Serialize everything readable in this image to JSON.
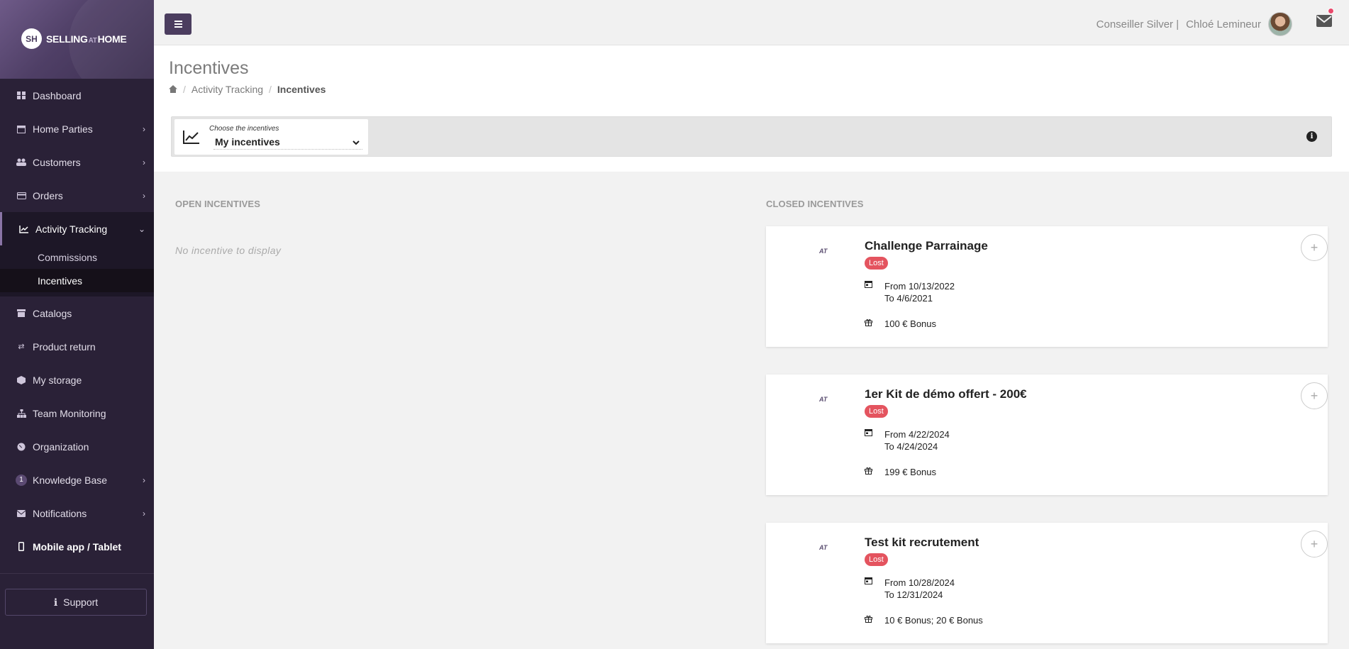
{
  "brand": {
    "logo_mark": "SH",
    "name_part1": "SELLING",
    "name_at": "AT",
    "name_part2": "HOME"
  },
  "sidebar": {
    "items": [
      {
        "label": "Dashboard",
        "icon": "dashboard-icon"
      },
      {
        "label": "Home Parties",
        "icon": "calendar-icon"
      },
      {
        "label": "Customers",
        "icon": "users-icon"
      },
      {
        "label": "Orders",
        "icon": "credit-card-icon"
      },
      {
        "label": "Activity Tracking",
        "icon": "line-chart-icon"
      },
      {
        "label": "Catalogs",
        "icon": "archive-icon"
      },
      {
        "label": "Product return",
        "icon": "exchange-icon"
      },
      {
        "label": "My storage",
        "icon": "cube-icon"
      },
      {
        "label": "Team Monitoring",
        "icon": "sitemap-icon"
      },
      {
        "label": "Organization",
        "icon": "globe-icon"
      },
      {
        "label": "Knowledge Base",
        "icon": "number-badge",
        "badge": "1"
      },
      {
        "label": "Notifications",
        "icon": "envelope-icon"
      },
      {
        "label": "Mobile app / Tablet",
        "icon": "mobile-icon"
      }
    ],
    "sub_items": [
      "Commissions",
      "Incentives"
    ],
    "support": "Support"
  },
  "topbar": {
    "user_role": "Conseiller Silver |",
    "user_name": "Chloé Lemineur"
  },
  "page": {
    "title": "Incentives",
    "breadcrumb": [
      "Activity Tracking",
      "Incentives"
    ]
  },
  "filter": {
    "caption": "Choose the incentives",
    "value": "My incentives"
  },
  "open_incentives": {
    "title": "OPEN INCENTIVES",
    "empty": "No incentive to display"
  },
  "closed_incentives": {
    "title": "CLOSED INCENTIVES",
    "cards": [
      {
        "brand": "AT",
        "title": "Challenge Parrainage",
        "status": "Lost",
        "from": "From 10/13/2022",
        "to": "To 4/6/2021",
        "reward": "100 € Bonus"
      },
      {
        "brand": "AT",
        "title": "1er Kit de démo offert - 200€",
        "status": "Lost",
        "from": "From 4/22/2024",
        "to": "To 4/24/2024",
        "reward": "199 € Bonus"
      },
      {
        "brand": "AT",
        "title": "Test kit recrutement",
        "status": "Lost",
        "from": "From 10/28/2024",
        "to": "To 12/31/2024",
        "reward": "10 € Bonus; 20 € Bonus"
      }
    ]
  },
  "colors": {
    "sidebar_bg": "#2a2137",
    "accent": "#4b3d5f",
    "lost_badge": "#e4545f",
    "notification_dot": "#e8496b"
  }
}
